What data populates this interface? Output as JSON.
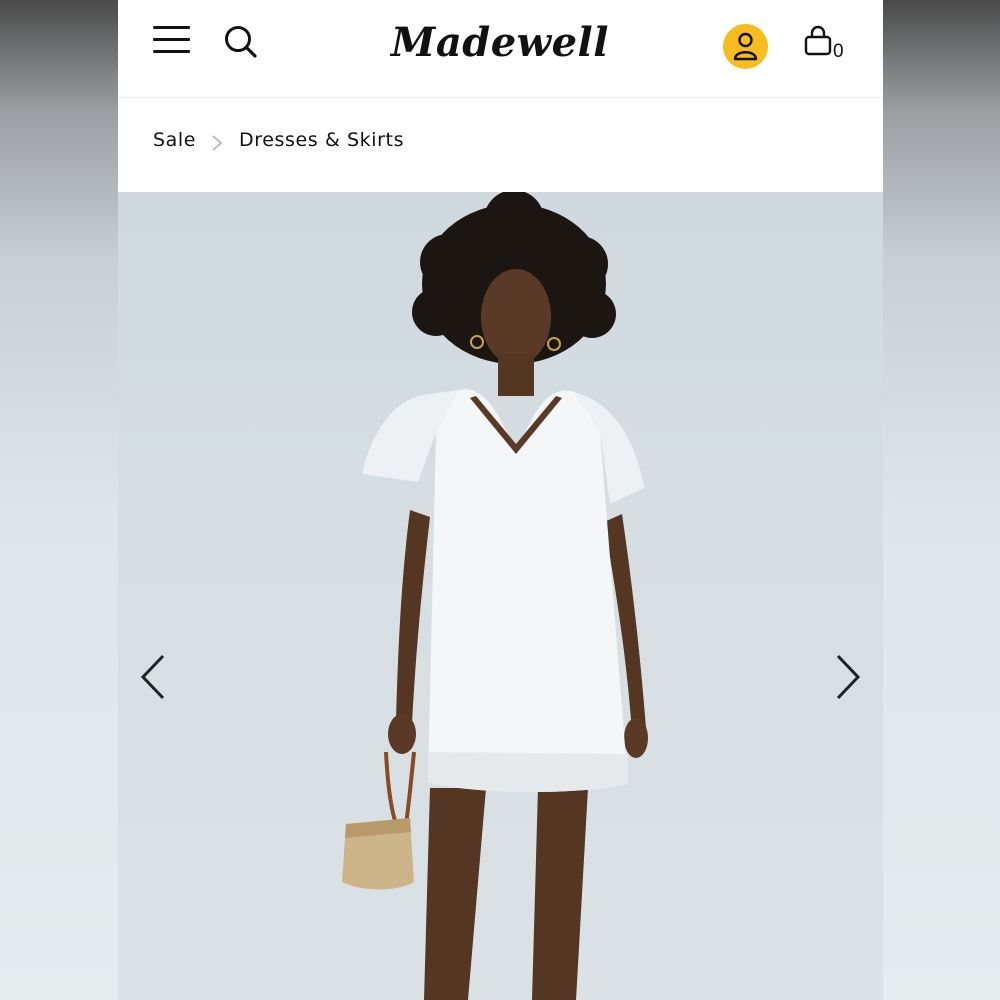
{
  "header": {
    "brand": "Madewell",
    "cart_count": "0",
    "menu_icon": "hamburger-menu-icon",
    "search_icon": "search-icon",
    "account_icon": "user-icon",
    "cart_icon": "shopping-bag-icon"
  },
  "breadcrumb": {
    "items": [
      "Sale",
      "Dresses & Skirts"
    ],
    "separator_icon": "chevron-right-icon"
  },
  "gallery": {
    "prev_icon": "chevron-left-icon",
    "next_icon": "chevron-right-icon"
  },
  "colors": {
    "accent": "#f7bc1f",
    "text": "#111111",
    "photo_background": "#d6dee2",
    "dress": "#f4f6f7"
  }
}
